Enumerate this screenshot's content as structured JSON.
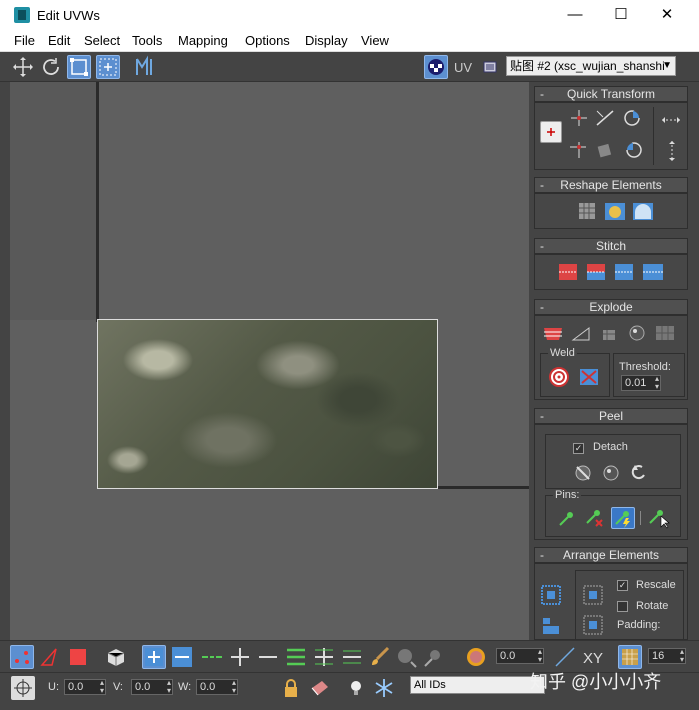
{
  "window": {
    "title": "Edit UVWs",
    "minimize": "—",
    "maximize": "☐",
    "close": "✕"
  },
  "menu": [
    "File",
    "Edit",
    "Select",
    "Tools",
    "Mapping",
    "Options",
    "Display",
    "View"
  ],
  "toolbar": {
    "uv_label": "UV",
    "map_select": "贴图 #2 (xsc_wujian_shanshi"
  },
  "panels": {
    "quick_transform": "Quick Transform",
    "reshape": "Reshape Elements",
    "stitch": "Stitch",
    "explode": "Explode",
    "weld": "Weld",
    "threshold_label": "Threshold:",
    "threshold_value": "0.01",
    "peel": "Peel",
    "detach": "Detach",
    "pins": "Pins:",
    "arrange": "Arrange Elements",
    "rescale": "Rescale",
    "rotate": "Rotate",
    "padding": "Padding:"
  },
  "bottom": {
    "spinner_value": "0.0",
    "xy_label": "XY",
    "grid_value": "16",
    "u_label": "U:",
    "u_value": "0.0",
    "v_label": "V:",
    "v_value": "0.0",
    "w_label": "W:",
    "w_value": "0.0",
    "ids_select": "All IDs"
  },
  "watermark": "知乎 @小小小齐",
  "colors": {
    "accent": "#5c8fd0",
    "panel": "#444444",
    "viewport": "#5f5f5f"
  }
}
